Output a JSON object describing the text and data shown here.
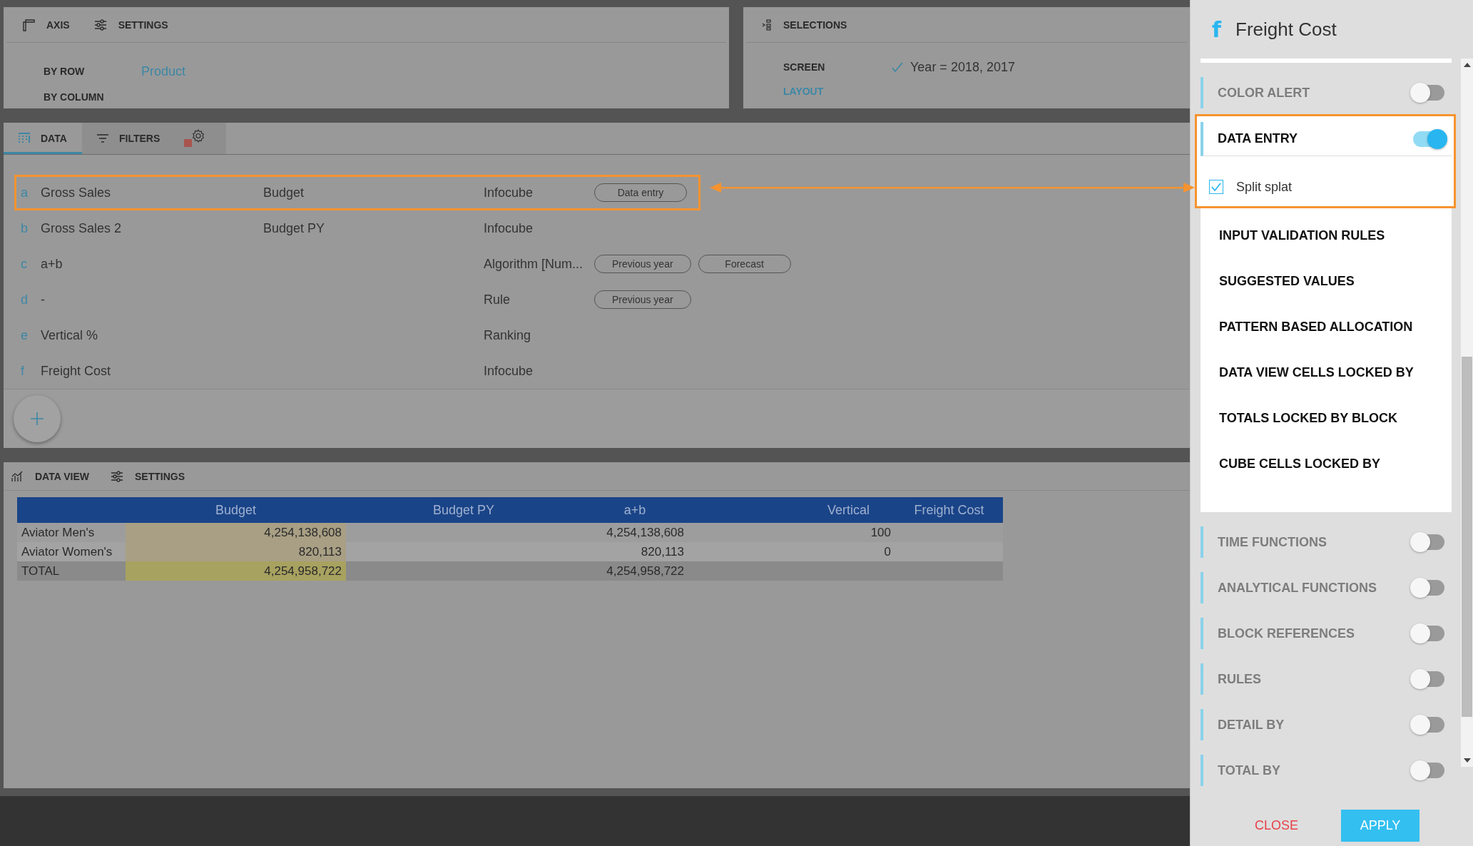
{
  "axis_panel": {
    "headers": [
      "AXIS",
      "SETTINGS"
    ],
    "rows": [
      {
        "label": "BY ROW",
        "value": "Product"
      },
      {
        "label": "BY COLUMN"
      }
    ]
  },
  "selections_panel": {
    "title": "SELECTIONS",
    "rows": [
      {
        "label": "SCREEN",
        "value": "Year = 2018, 2017",
        "checked": true,
        "selected": false
      },
      {
        "label": "LAYOUT",
        "selected": true
      }
    ]
  },
  "data_panel": {
    "tabs": [
      {
        "label": "DATA",
        "selected": true
      },
      {
        "label": "FILTERS",
        "selected": false
      }
    ],
    "rows": [
      {
        "letter": "a",
        "name": "Gross Sales",
        "column_2": "Budget",
        "type": "Infocube",
        "tags": [
          "Data entry"
        ],
        "highlighted": true
      },
      {
        "letter": "b",
        "name": "Gross Sales 2",
        "column_2": "Budget PY",
        "type": "Infocube",
        "highlighted": false
      },
      {
        "letter": "c",
        "name": "a+b",
        "type": "Algorithm [Num...",
        "tags": [
          "Previous year",
          "Forecast"
        ],
        "highlighted": false
      },
      {
        "letter": "d",
        "name": "-",
        "type": "Rule",
        "tags": [
          "Previous year"
        ],
        "highlighted": false
      },
      {
        "letter": "e",
        "name": "Vertical %",
        "type": "Ranking",
        "highlighted": false
      },
      {
        "letter": "f",
        "name": "Freight Cost",
        "type": "Infocube",
        "highlighted": false
      }
    ]
  },
  "data_view": {
    "headers": [
      "DATA VIEW",
      "SETTINGS"
    ],
    "table": {
      "columns": [
        {
          "label": "Budget",
          "highlighted": true
        },
        {
          "label": "Budget PY",
          "highlighted": false
        },
        {
          "label": "a+b",
          "highlighted": false
        },
        {
          "label": "Vertical",
          "highlighted": false
        },
        {
          "label": "Freight Cost",
          "highlighted": false
        }
      ],
      "rows": [
        {
          "kind": "data",
          "label": "Aviator Men's",
          "cells": [
            "4,254,138,608",
            null,
            "4,254,138,608",
            "100",
            null
          ]
        },
        {
          "kind": "data",
          "label": "Aviator Women's",
          "cells": [
            "820,113",
            null,
            "820,113",
            "0",
            null
          ]
        },
        {
          "kind": "total",
          "label": "TOTAL",
          "cells": [
            "4,254,958,722",
            null,
            "4,254,958,722",
            null,
            null
          ]
        }
      ]
    }
  },
  "side_panel": {
    "badge": "f",
    "title": "Freight Cost",
    "sections": [
      {
        "label": "COLOR ALERT",
        "on": false,
        "expanded": false,
        "highlighted": false
      },
      {
        "label": "DATA ENTRY",
        "on": true,
        "expanded": true,
        "highlighted": true,
        "options": [
          {
            "label": "Split splat",
            "checked": true
          }
        ],
        "subsections": [
          "INPUT VALIDATION RULES",
          "SUGGESTED VALUES",
          "PATTERN BASED ALLOCATION",
          "DATA VIEW CELLS LOCKED BY",
          "TOTALS LOCKED BY BLOCK",
          "CUBE CELLS LOCKED BY"
        ]
      },
      {
        "label": "TIME FUNCTIONS",
        "on": false,
        "expanded": false,
        "highlighted": false
      },
      {
        "label": "ANALYTICAL FUNCTIONS",
        "on": false,
        "expanded": false,
        "highlighted": false
      },
      {
        "label": "BLOCK REFERENCES",
        "on": false,
        "expanded": false,
        "highlighted": false
      },
      {
        "label": "RULES",
        "on": false,
        "expanded": false,
        "highlighted": false
      },
      {
        "label": "DETAIL BY",
        "on": false,
        "expanded": false,
        "highlighted": false
      },
      {
        "label": "TOTAL BY",
        "on": false,
        "expanded": false,
        "highlighted": false
      }
    ],
    "buttons": [
      {
        "label": "CLOSE",
        "kind": "text"
      },
      {
        "label": "APPLY",
        "kind": "primary"
      }
    ]
  }
}
